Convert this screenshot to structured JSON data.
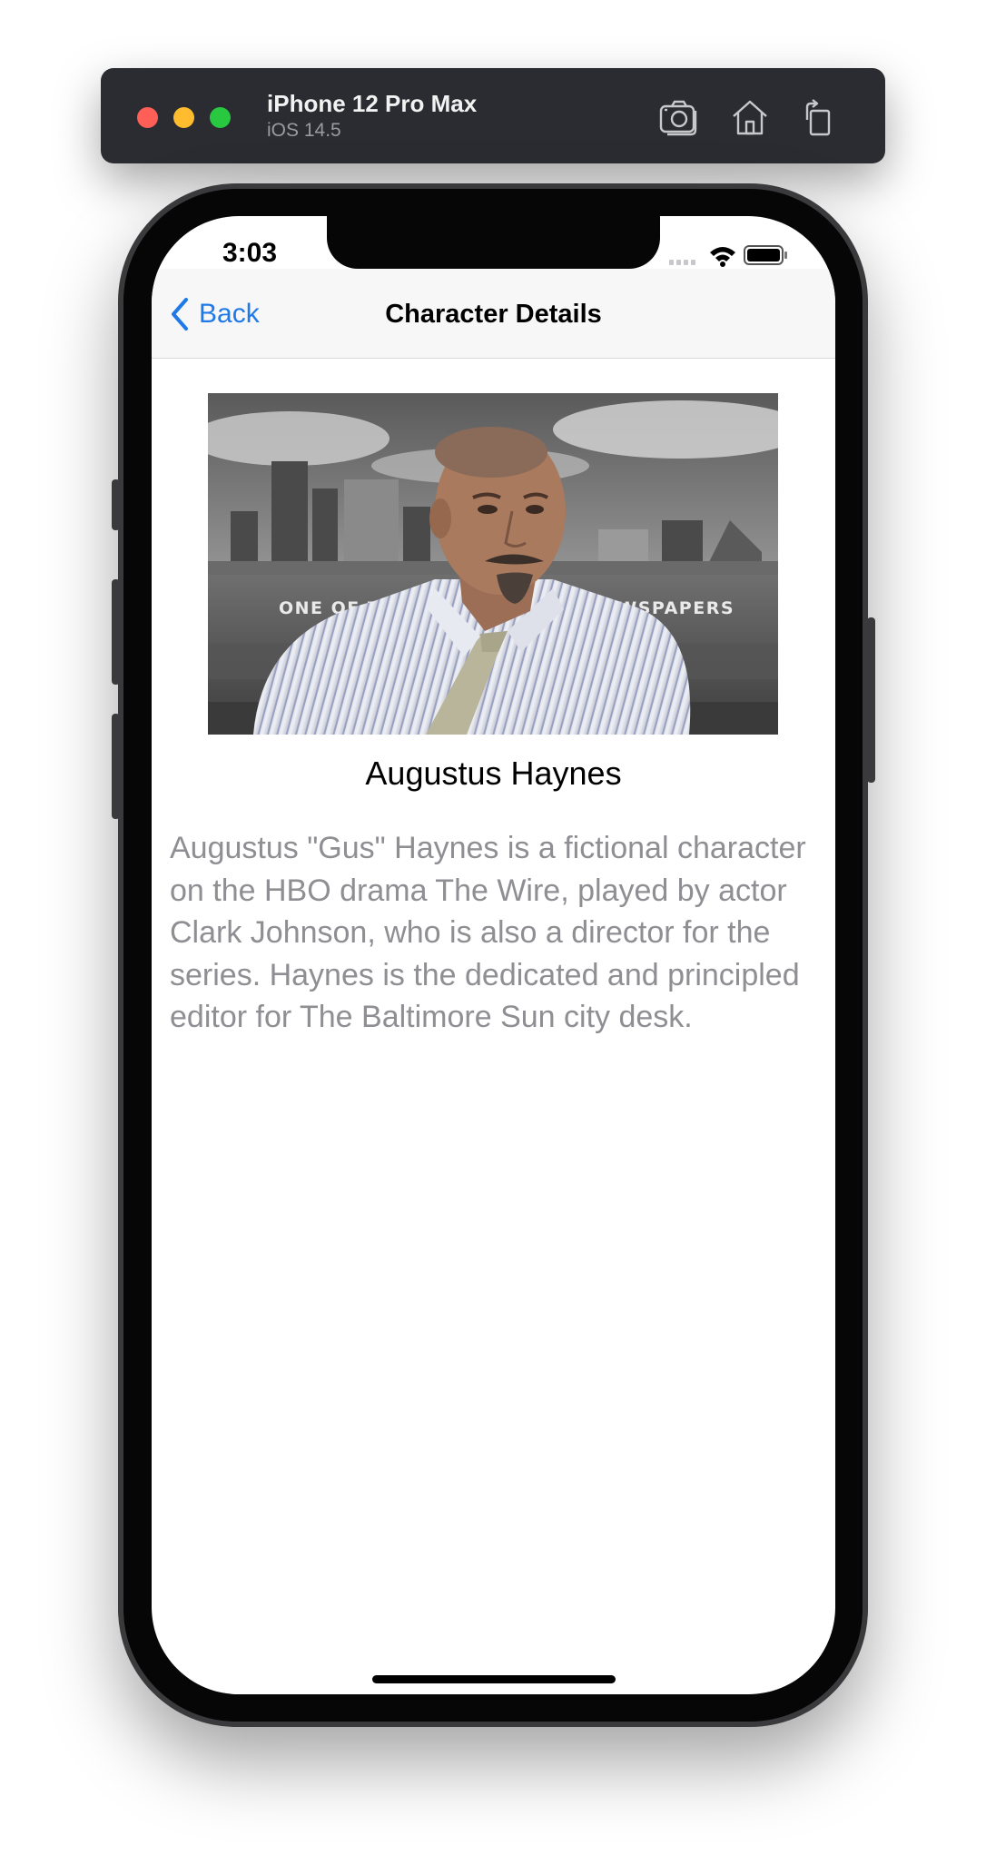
{
  "simulator": {
    "device_name": "iPhone 12 Pro Max",
    "os_version": "iOS 14.5",
    "tools": [
      "screenshot-icon",
      "home-icon",
      "rotate-icon"
    ]
  },
  "status_bar": {
    "time": "3:03"
  },
  "nav": {
    "back_label": "Back",
    "title": "Character Details"
  },
  "character": {
    "photo_overlay_text": "ONE OF THE NATION'S BEST NEWSPAPERS",
    "name": "Augustus Haynes",
    "description": "Augustus \"Gus\" Haynes is a fictional character on the HBO drama The Wire, played by actor Clark Johnson, who is also a director for the series. Haynes is the dedicated and principled editor for The Baltimore Sun city desk."
  },
  "colors": {
    "accent": "#1f7ae8",
    "description_text": "#8e8e93"
  }
}
